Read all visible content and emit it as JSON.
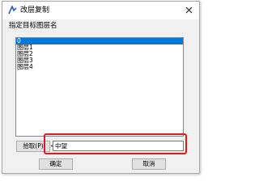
{
  "dialog": {
    "title": "改层复制",
    "prompt": "指定目标图层名"
  },
  "layers": [
    "0",
    "图层1",
    "图层2",
    "图层3",
    "图层4"
  ],
  "selected_index": 0,
  "pick_button": {
    "label": "拾取(P)",
    "suffix": "<"
  },
  "name_input": {
    "value": "中望"
  },
  "buttons": {
    "ok": "确定",
    "cancel": "取消"
  },
  "colors": {
    "selection": "#0078d7",
    "highlight": "#e0191b"
  }
}
